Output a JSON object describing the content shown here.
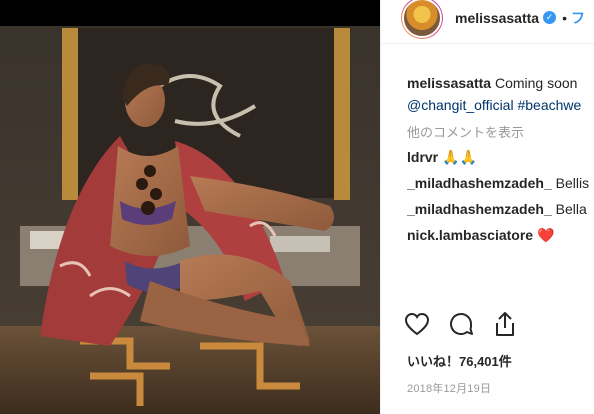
{
  "header": {
    "username": "melissasatta",
    "follow_label": "フ"
  },
  "caption": {
    "username": "melissasatta",
    "text": "Coming soon",
    "tags": "@changit_official #beachwe"
  },
  "more_comments_label": "他のコメントを表示",
  "comments": [
    {
      "username": "ldrvr",
      "text": "🙏🙏"
    },
    {
      "username": "_miladhashemzadeh_",
      "text": "Bellis"
    },
    {
      "username": "_miladhashemzadeh_",
      "text": "Bella"
    },
    {
      "username": "nick.lambasciatore",
      "text": "❤️"
    }
  ],
  "actions": {
    "like_icon": "heart-outline-icon",
    "comment_icon": "speech-bubble-icon",
    "share_icon": "share-upload-icon"
  },
  "likes_label": "いいね！76,401件",
  "date_label": "2018年12月19日",
  "colors": {
    "link": "#3897f0",
    "hashtag": "#003569",
    "muted": "#999999"
  }
}
